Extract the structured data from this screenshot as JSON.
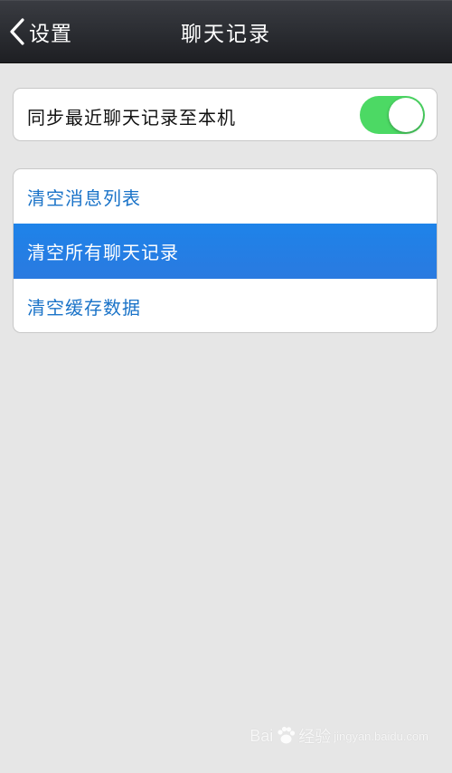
{
  "nav": {
    "back_label": "设置",
    "title": "聊天记录"
  },
  "sync": {
    "label": "同步最近聊天记录至本机",
    "enabled": true,
    "toggle_color": "#4cd964"
  },
  "actions": [
    {
      "label": "清空消息列表",
      "highlighted": false
    },
    {
      "label": "清空所有聊天记录",
      "highlighted": true
    },
    {
      "label": "清空缓存数据",
      "highlighted": false
    }
  ],
  "colors": {
    "link": "#1a73c8",
    "highlight": "#2a7ae0",
    "background": "#e6e6e6"
  },
  "watermark": {
    "brand_left": "Bai",
    "brand_right": "经验",
    "sub": "jingyan.baidu.com"
  }
}
